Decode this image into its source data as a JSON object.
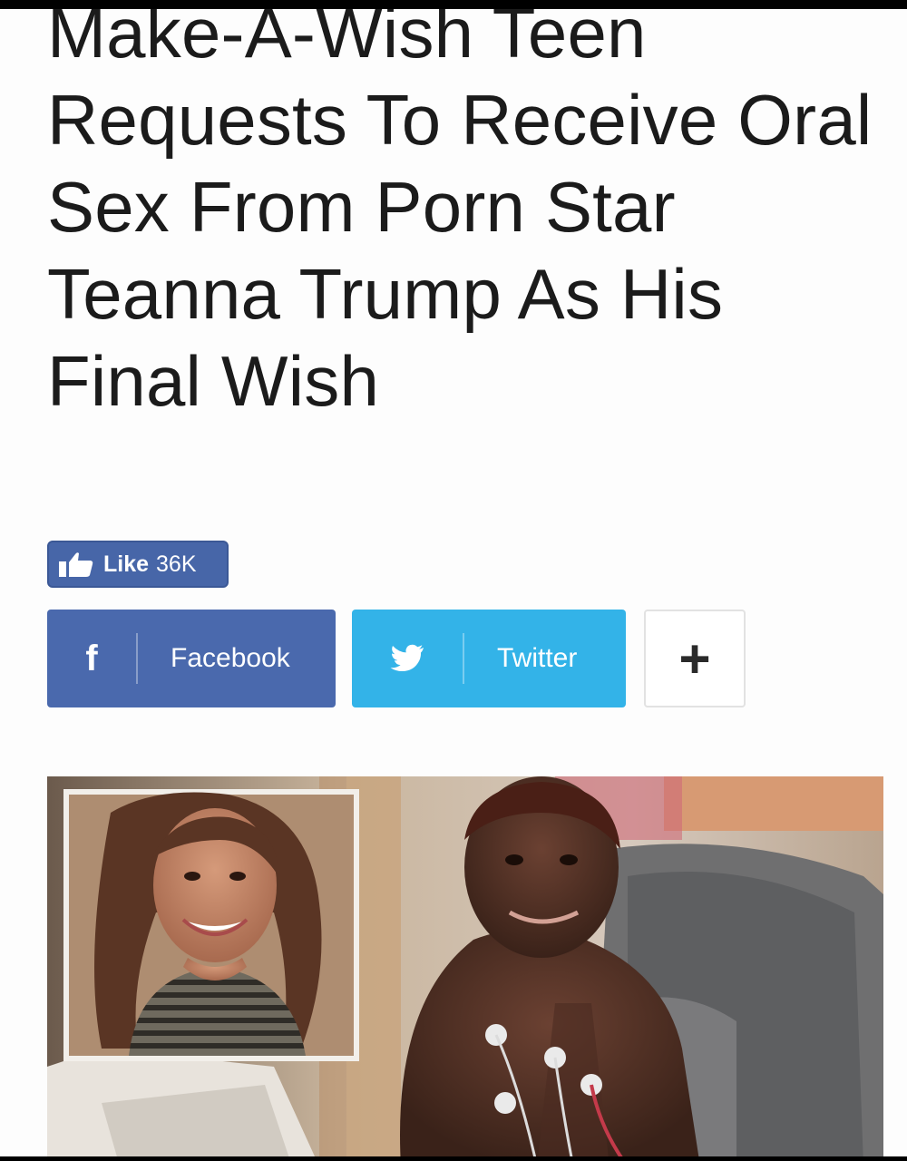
{
  "article": {
    "headline": "Make-A-Wish Teen Requests To Receive Oral Sex From Porn Star Teanna Trump As His Final Wish"
  },
  "like": {
    "label": "Like",
    "count": "36K",
    "icon": "thumbs-up-icon",
    "color": "#4766a8"
  },
  "share": {
    "facebook": {
      "label": "Facebook",
      "icon": "facebook-icon",
      "color": "#4a69ad"
    },
    "twitter": {
      "label": "Twitter",
      "icon": "twitter-bird-icon",
      "color": "#33b3e8"
    },
    "more": {
      "label": "+",
      "icon": "plus-icon"
    }
  },
  "image": {
    "icon": "article-photo"
  }
}
